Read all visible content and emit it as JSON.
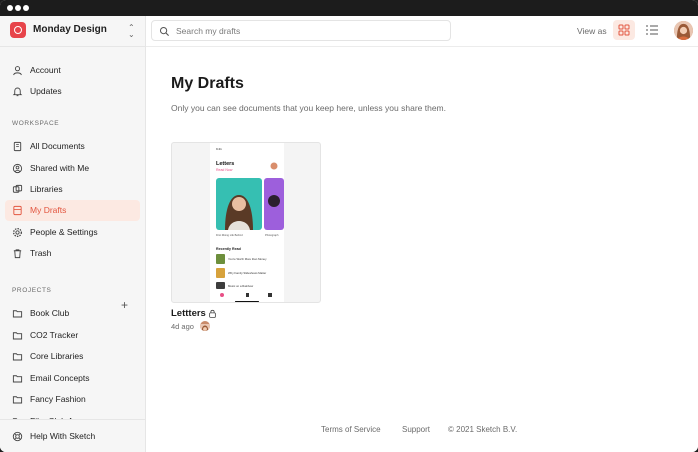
{
  "workspace": {
    "name": "Monday Design"
  },
  "sidebar": {
    "top_items": [
      {
        "label": "Account",
        "icon": "user-icon"
      },
      {
        "label": "Updates",
        "icon": "bell-icon"
      }
    ],
    "workspace_title": "WORKSPACE",
    "workspace_items": [
      {
        "label": "All Documents",
        "icon": "documents-icon"
      },
      {
        "label": "Shared with Me",
        "icon": "shared-icon"
      },
      {
        "label": "Libraries",
        "icon": "libraries-icon"
      },
      {
        "label": "My Drafts",
        "icon": "drafts-icon",
        "active": true
      },
      {
        "label": "People & Settings",
        "icon": "gear-icon"
      },
      {
        "label": "Trash",
        "icon": "trash-icon"
      }
    ],
    "projects_title": "PROJECTS",
    "projects": [
      {
        "label": "Book Club"
      },
      {
        "label": "CO2 Tracker"
      },
      {
        "label": "Core Libraries"
      },
      {
        "label": "Email Concepts"
      },
      {
        "label": "Fancy Fashion"
      },
      {
        "label": "Film Club Ap..."
      }
    ],
    "help_label": "Help With Sketch"
  },
  "topbar": {
    "search_placeholder": "Search my drafts",
    "view_as_label": "View as",
    "view_mode": "grid"
  },
  "main": {
    "title": "My Drafts",
    "subtitle": "Only you can see documents that you keep here, unless you share them.",
    "documents": [
      {
        "name": "Lettters",
        "updated": "4d ago",
        "locked": true,
        "preview": {
          "heading": "Letters",
          "link": "Read Now",
          "caption_1": "First Rising Life Behind",
          "caption_2": "Photograph",
          "section": "Recently Read",
          "rows": [
            "You're Worth More than Money",
            "Why Family Slideshows Matter",
            "Music on a Rainbow"
          ]
        }
      }
    ]
  },
  "footer": {
    "terms": "Terms of Service",
    "support": "Support",
    "copyright": "© 2021 Sketch B.V."
  },
  "colors": {
    "accent": "#e2553f",
    "active_bg": "#fce9e2",
    "logo": "#e7444a"
  }
}
